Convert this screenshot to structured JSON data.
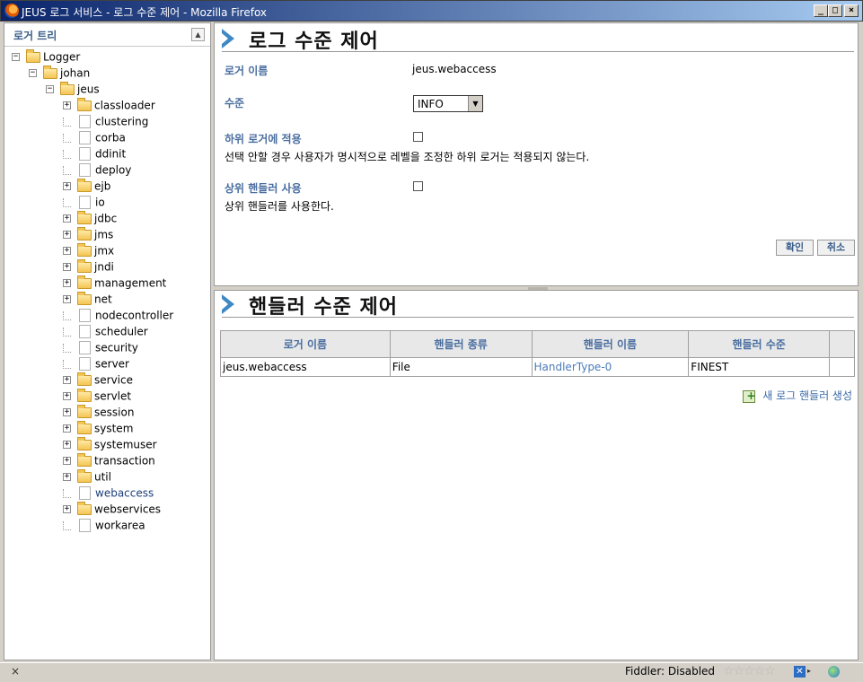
{
  "window": {
    "title": "JEUS 로그 서비스 - 로그 수준 제어 - Mozilla Firefox",
    "min_label": "_",
    "max_label": "□",
    "close_label": "×"
  },
  "left_panel": {
    "title": "로거 트리",
    "collapse_label": "▲",
    "tree": [
      {
        "label": "Logger",
        "level": 0,
        "type": "folder-open",
        "toggle": "−"
      },
      {
        "label": "johan",
        "level": 1,
        "type": "folder-open",
        "toggle": "−"
      },
      {
        "label": "jeus",
        "level": 2,
        "type": "folder-open",
        "toggle": "−"
      },
      {
        "label": "classloader",
        "level": 3,
        "type": "folder",
        "toggle": "+"
      },
      {
        "label": "clustering",
        "level": 3,
        "type": "file",
        "toggle": ""
      },
      {
        "label": "corba",
        "level": 3,
        "type": "file",
        "toggle": ""
      },
      {
        "label": "ddinit",
        "level": 3,
        "type": "file",
        "toggle": ""
      },
      {
        "label": "deploy",
        "level": 3,
        "type": "file",
        "toggle": ""
      },
      {
        "label": "ejb",
        "level": 3,
        "type": "folder",
        "toggle": "+"
      },
      {
        "label": "io",
        "level": 3,
        "type": "file",
        "toggle": ""
      },
      {
        "label": "jdbc",
        "level": 3,
        "type": "folder",
        "toggle": "+"
      },
      {
        "label": "jms",
        "level": 3,
        "type": "folder",
        "toggle": "+"
      },
      {
        "label": "jmx",
        "level": 3,
        "type": "folder",
        "toggle": "+"
      },
      {
        "label": "jndi",
        "level": 3,
        "type": "folder",
        "toggle": "+"
      },
      {
        "label": "management",
        "level": 3,
        "type": "folder",
        "toggle": "+"
      },
      {
        "label": "net",
        "level": 3,
        "type": "folder",
        "toggle": "+"
      },
      {
        "label": "nodecontroller",
        "level": 3,
        "type": "file",
        "toggle": ""
      },
      {
        "label": "scheduler",
        "level": 3,
        "type": "file",
        "toggle": ""
      },
      {
        "label": "security",
        "level": 3,
        "type": "file",
        "toggle": ""
      },
      {
        "label": "server",
        "level": 3,
        "type": "file",
        "toggle": ""
      },
      {
        "label": "service",
        "level": 3,
        "type": "folder",
        "toggle": "+"
      },
      {
        "label": "servlet",
        "level": 3,
        "type": "folder",
        "toggle": "+"
      },
      {
        "label": "session",
        "level": 3,
        "type": "folder",
        "toggle": "+"
      },
      {
        "label": "system",
        "level": 3,
        "type": "folder",
        "toggle": "+"
      },
      {
        "label": "systemuser",
        "level": 3,
        "type": "folder",
        "toggle": "+"
      },
      {
        "label": "transaction",
        "level": 3,
        "type": "folder",
        "toggle": "+"
      },
      {
        "label": "util",
        "level": 3,
        "type": "folder",
        "toggle": "+"
      },
      {
        "label": "webaccess",
        "level": 3,
        "type": "file",
        "toggle": "",
        "selected": true
      },
      {
        "label": "webservices",
        "level": 3,
        "type": "folder",
        "toggle": "+"
      },
      {
        "label": "workarea",
        "level": 3,
        "type": "file",
        "toggle": ""
      }
    ]
  },
  "log_level": {
    "title": "로그 수준 제어",
    "logger_name_label": "로거 이름",
    "logger_name_value": "jeus.webaccess",
    "level_label": "수준",
    "level_value": "INFO",
    "apply_children_label": "하위 로거에 적용",
    "apply_children_desc": "선택 안할 경우 사용자가 명시적으로 레벨을 조정한 하위 로거는 적용되지 않는다.",
    "use_parent_label": "상위 핸들러 사용",
    "use_parent_desc": "상위 핸들러를 사용한다.",
    "ok_button": "확인",
    "cancel_button": "취소"
  },
  "handler_level": {
    "title": "핸들러 수준 제어",
    "columns": [
      "로거 이름",
      "핸들러 종류",
      "핸들러 이름",
      "핸들러 수준"
    ],
    "rows": [
      [
        "jeus.webaccess",
        "File",
        "HandlerType-0",
        "FINEST"
      ]
    ],
    "new_handler_link": "새 로그 핸들러 생성"
  },
  "statusbar": {
    "close": "×",
    "fiddler": "Fiddler: Disabled",
    "stars": "☆☆☆☆☆",
    "addon_icon": "✕",
    "addon_arrow": "▸"
  }
}
